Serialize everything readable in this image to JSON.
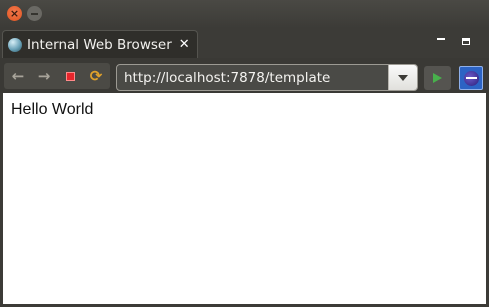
{
  "window": {
    "close_icon": "×",
    "minimize_icon": "minimize"
  },
  "tab": {
    "label": "Internal Web Browser",
    "close_icon": "✕",
    "icon": "globe-icon"
  },
  "view_controls": {
    "minimize": "minimize-icon",
    "maximize": "maximize-icon"
  },
  "toolbar": {
    "back_icon": "🡐",
    "forward_icon": "🡒",
    "stop_icon": "stop-icon",
    "refresh_icon": "refresh-icon",
    "go_icon": "go-icon",
    "eclipse_icon": "eclipse-icon"
  },
  "address_bar": {
    "url": "http://localhost:7878/template"
  },
  "page": {
    "body_text": "Hello World"
  },
  "colors": {
    "close_button": "#e0541f",
    "stop": "#e8262c",
    "go": "#48b04c",
    "eclipse": "#2c63c4"
  }
}
